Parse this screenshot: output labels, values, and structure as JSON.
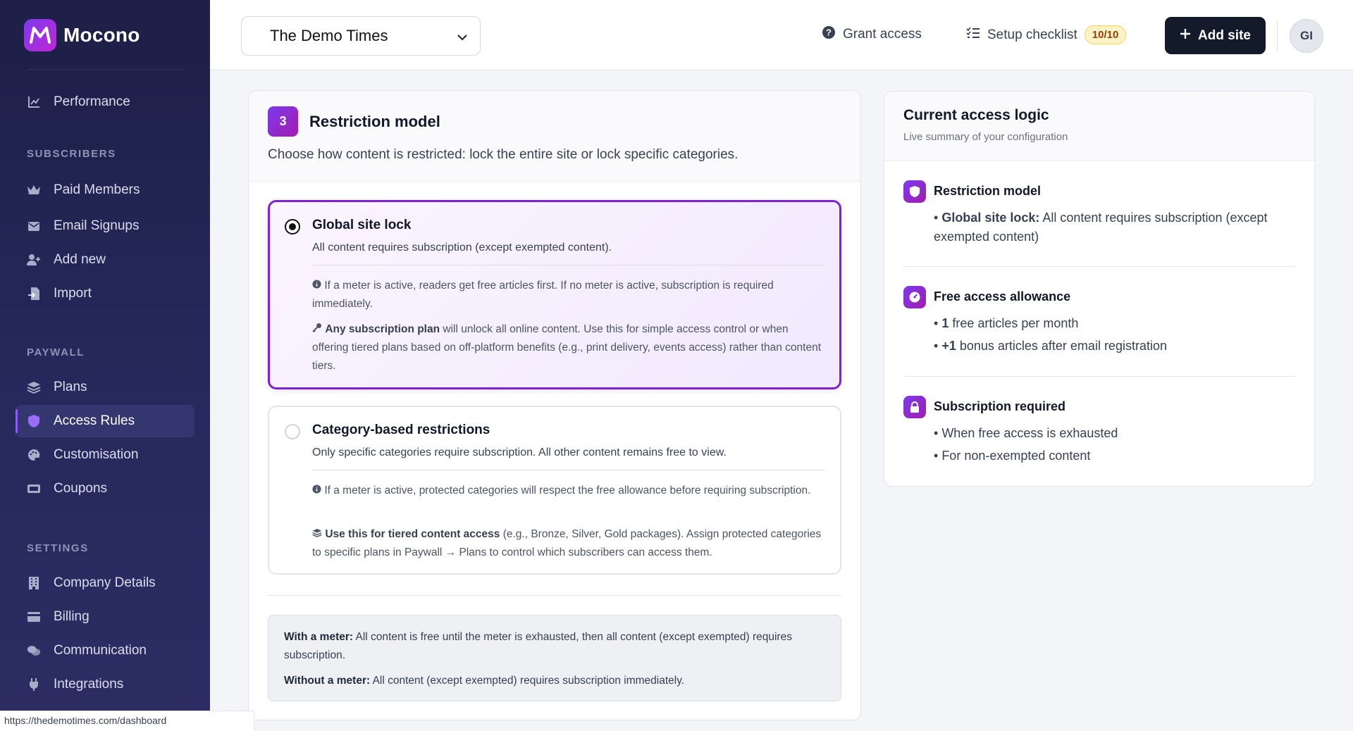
{
  "app": {
    "name": "Mocono"
  },
  "sidebar": {
    "top_item": {
      "label": "Performance",
      "icon": "chart-line-icon"
    },
    "sections": [
      {
        "title": "SUBSCRIBERS",
        "items": [
          {
            "label": "Paid Members",
            "icon": "crown-icon"
          },
          {
            "label": "Email Signups",
            "icon": "envelope-icon"
          },
          {
            "label": "Add new",
            "icon": "user-plus-icon"
          },
          {
            "label": "Import",
            "icon": "file-import-icon"
          }
        ]
      },
      {
        "title": "PAYWALL",
        "items": [
          {
            "label": "Plans",
            "icon": "layers-icon"
          },
          {
            "label": "Access Rules",
            "icon": "shield-icon",
            "active": true
          },
          {
            "label": "Customisation",
            "icon": "palette-icon"
          },
          {
            "label": "Coupons",
            "icon": "ticket-icon"
          }
        ]
      },
      {
        "title": "SETTINGS",
        "items": [
          {
            "label": "Company Details",
            "icon": "building-icon"
          },
          {
            "label": "Billing",
            "icon": "credit-card-icon"
          },
          {
            "label": "Communication",
            "icon": "comments-icon"
          },
          {
            "label": "Integrations",
            "icon": "plug-icon"
          }
        ]
      }
    ]
  },
  "header": {
    "site_select": {
      "value": "The Demo Times"
    },
    "grant_access": "Grant access",
    "setup_checklist": {
      "label": "Setup checklist",
      "badge": "10/10"
    },
    "add_site": "Add site",
    "avatar_initials": "GI"
  },
  "restriction": {
    "step_number": "3",
    "title": "Restriction model",
    "description": "Choose how content is restricted: lock the entire site or lock specific categories.",
    "options": [
      {
        "title": "Global site lock",
        "subtitle": "All content requires subscription (except exempted content).",
        "selected": true,
        "note1": "If a meter is active, readers get free articles first. If no meter is active, subscription is required immediately.",
        "note2_bold": "Any subscription plan",
        "note2_rest": " will unlock all online content. Use this for simple access control or when offering tiered plans based on off-platform benefits (e.g., print delivery, events access) rather than content tiers."
      },
      {
        "title": "Category-based restrictions",
        "subtitle": "Only specific categories require subscription. All other content remains free to view.",
        "selected": false,
        "note1": "If a meter is active, protected categories will respect the free allowance before requiring subscription.",
        "note2_bold": "Use this for tiered content access",
        "note2_rest": " (e.g., Bronze, Silver, Gold packages). Assign protected categories to specific plans in Paywall → Plans to control which subscribers can access them."
      }
    ],
    "info": {
      "meter_bold": "With a meter:",
      "meter_text": " All content is free until the meter is exhausted, then all content (except exempted) requires subscription.",
      "nometer_bold": "Without a meter:",
      "nometer_text": " All content (except exempted) requires subscription immediately."
    }
  },
  "logic": {
    "title": "Current access logic",
    "subtitle": "Live summary of your configuration",
    "restriction": {
      "title": "Restriction model",
      "bold": "Global site lock:",
      "text": " All content requires subscription (except exempted content)"
    },
    "allowance": {
      "title": "Free access allowance",
      "item1_bold": "1",
      "item1_text": " free articles per month",
      "item2_bold": "+1",
      "item2_text": " bonus articles after email registration"
    },
    "required": {
      "title": "Subscription required",
      "item1": "When free access is exhausted",
      "item2": "For non-exempted content"
    }
  },
  "status_bar": {
    "url": "https://thedemotimes.com/dashboard"
  },
  "colors": {
    "accent": "#7e22ce",
    "sidebar": "#24265a",
    "primary_button": "#131a2a"
  }
}
